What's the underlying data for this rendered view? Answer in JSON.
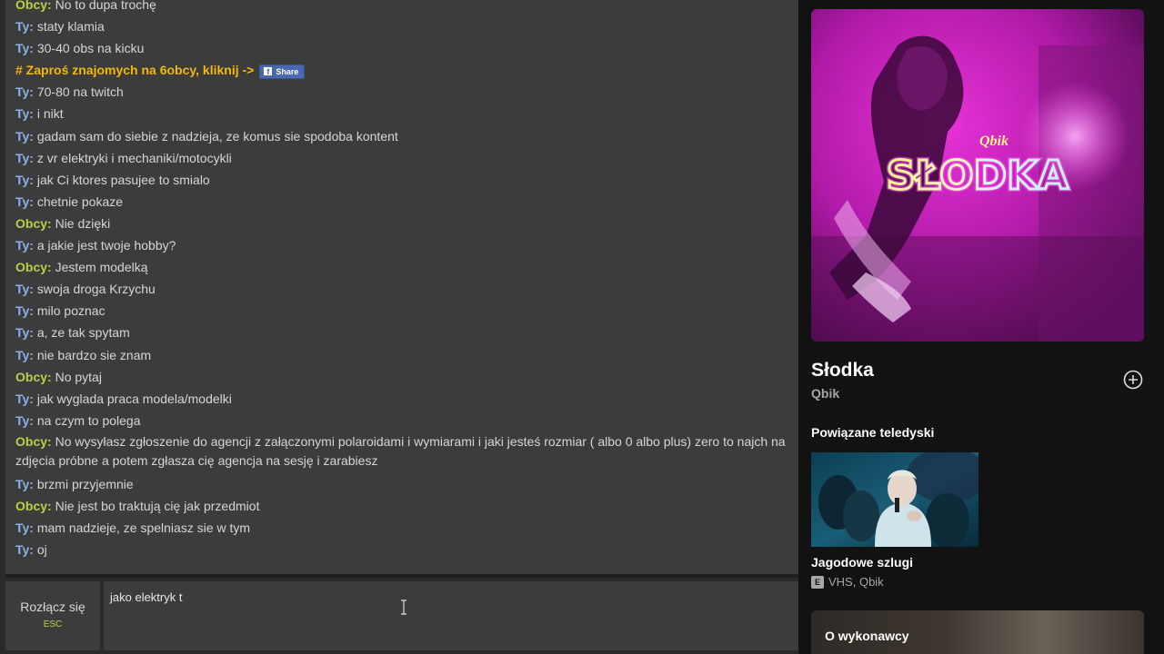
{
  "chat": {
    "messages": [
      {
        "speaker": "Obcy:",
        "role": "stranger",
        "text": "No to dupa trochę"
      },
      {
        "speaker": "Ty:",
        "role": "you",
        "text": "staty klamia"
      },
      {
        "speaker": "Ty:",
        "role": "you",
        "text": "30-40 obs na kicku"
      },
      {
        "type": "promo",
        "text": "# Zaproś znajomych na 6obcy, kliknij ->",
        "share_label": "Share",
        "share_icon": "facebook-icon"
      },
      {
        "speaker": "Ty:",
        "role": "you",
        "text": "70-80 na twitch"
      },
      {
        "speaker": "Ty:",
        "role": "you",
        "text": "i nikt"
      },
      {
        "speaker": "Ty:",
        "role": "you",
        "text": "gadam sam do siebie z nadzieja, ze komus sie spodoba kontent"
      },
      {
        "speaker": "Ty:",
        "role": "you",
        "text": "z vr elektryki i mechaniki/motocykli"
      },
      {
        "speaker": "Ty:",
        "role": "you",
        "text": "jak Ci ktores pasujee to smialo"
      },
      {
        "speaker": "Ty:",
        "role": "you",
        "text": "chetnie pokaze"
      },
      {
        "speaker": "Obcy:",
        "role": "stranger",
        "text": "Nie dzięki"
      },
      {
        "speaker": "Ty:",
        "role": "you",
        "text": "a jakie jest twoje hobby?"
      },
      {
        "speaker": "Obcy:",
        "role": "stranger",
        "text": "Jestem modelką"
      },
      {
        "speaker": "Ty:",
        "role": "you",
        "text": "swoja droga Krzychu"
      },
      {
        "speaker": "Ty:",
        "role": "you",
        "text": "milo poznac"
      },
      {
        "speaker": "Ty:",
        "role": "you",
        "text": "a, ze tak spytam"
      },
      {
        "speaker": "Ty:",
        "role": "you",
        "text": "nie bardzo sie znam"
      },
      {
        "speaker": "Obcy:",
        "role": "stranger",
        "text": "No pytaj"
      },
      {
        "speaker": "Ty:",
        "role": "you",
        "text": "jak wyglada praca modela/modelki"
      },
      {
        "speaker": "Ty:",
        "role": "you",
        "text": "na czym to polega"
      },
      {
        "speaker": "Obcy:",
        "role": "stranger",
        "wrap": true,
        "text": "No wysyłasz zgłoszenie do agencji z załączonymi polaroidami i wymiarami i jaki jesteś rozmiar ( albo 0 albo plus) zero to najch na zdjęcia próbne a potem zgłasza cię agencja na sesję i zarabiesz"
      },
      {
        "speaker": "Ty:",
        "role": "you",
        "text": "brzmi przyjemnie"
      },
      {
        "speaker": "Obcy:",
        "role": "stranger",
        "text": "Nie jest bo traktują cię jak przedmiot"
      },
      {
        "speaker": "Ty:",
        "role": "you",
        "text": "mam nadzieje, ze spelniasz sie w tym"
      },
      {
        "speaker": "Ty:",
        "role": "you",
        "text": "oj"
      }
    ],
    "disconnect": {
      "label": "Rozłącz się",
      "hint": "ESC"
    },
    "input": {
      "value": "jako elektryk t"
    },
    "colors": {
      "you": "#8ab0e8",
      "stranger": "#b7d04c",
      "promo": "#f0b90f"
    }
  },
  "now_playing": {
    "cover": {
      "script_text": "Qbik",
      "neon_text": "SŁODKA"
    },
    "title": "Słodka",
    "artist": "Qbik",
    "add_icon": "plus-circle-icon"
  },
  "related": {
    "heading": "Powiązane teledyski",
    "items": [
      {
        "title": "Jagodowe szlugi",
        "explicit": "E",
        "artists": "VHS, Qbik"
      }
    ]
  },
  "artist_card": {
    "title": "O wykonawcy"
  }
}
